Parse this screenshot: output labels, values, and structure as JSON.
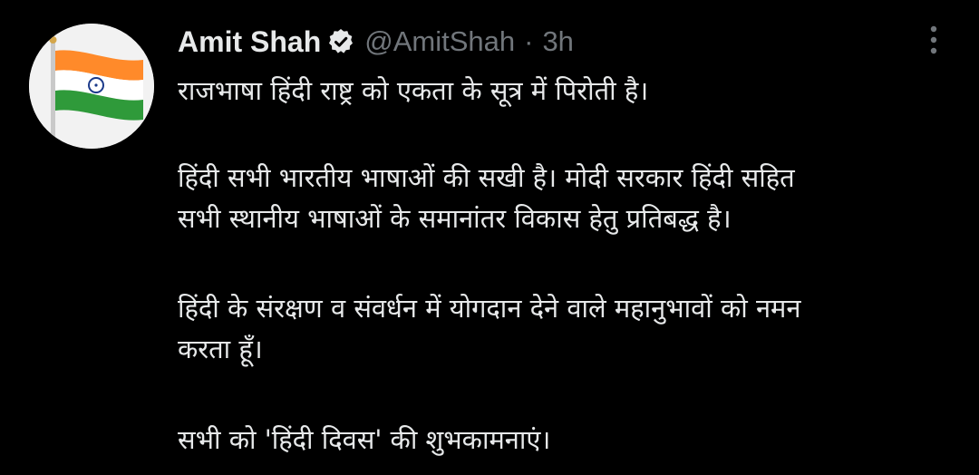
{
  "tweet": {
    "author_name": "Amit Shah",
    "handle": "@AmitShah",
    "separator": "·",
    "time": "3h",
    "icons": {
      "verified": "verified-badge-icon",
      "more": "more-options-icon"
    },
    "colors": {
      "background": "#000000",
      "text": "#e7e9ea",
      "secondary_text": "#71767b"
    },
    "lines": {
      "line1": "राजभाषा हिंदी राष्ट्र को एकता के सूत्र में पिरोती है।",
      "line2a": "हिंदी सभी भारतीय भाषाओं की सखी है। मोदी सरकार हिंदी सहित",
      "line2b": "सभी स्थानीय भाषाओं के समानांतर विकास हेतु प्रतिबद्ध है।",
      "line3a": "हिंदी के संरक्षण व संवर्धन में योगदान देने वाले महानुभावों को नमन",
      "line3b": "करता हूँ।",
      "line4": "सभी को 'हिंदी दिवस' की शुभकामनाएं।"
    }
  }
}
